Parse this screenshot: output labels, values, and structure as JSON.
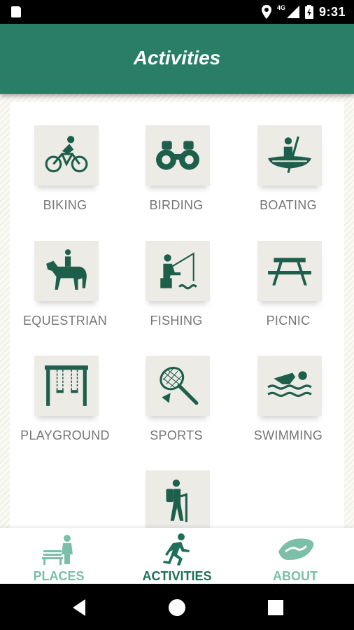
{
  "status_bar": {
    "time": "9:31",
    "network": "4G"
  },
  "app_bar": {
    "title": "Activities"
  },
  "activities": [
    {
      "label": "BIKING",
      "icon": "biking-icon"
    },
    {
      "label": "BIRDING",
      "icon": "binoculars-icon"
    },
    {
      "label": "BOATING",
      "icon": "canoe-icon"
    },
    {
      "label": "EQUESTRIAN",
      "icon": "horse-rider-icon"
    },
    {
      "label": "FISHING",
      "icon": "fishing-icon"
    },
    {
      "label": "PICNIC",
      "icon": "picnic-table-icon"
    },
    {
      "label": "PLAYGROUND",
      "icon": "swing-set-icon"
    },
    {
      "label": "SPORTS",
      "icon": "racket-icon"
    },
    {
      "label": "SWIMMING",
      "icon": "swimmer-icon"
    },
    {
      "label": "",
      "icon": "hiker-icon"
    }
  ],
  "bottom_nav": {
    "places": "PLACES",
    "activities": "ACTIVITIES",
    "about": "ABOUT",
    "active": "activities"
  },
  "colors": {
    "primary": "#2a7e68",
    "icon": "#1e5f4c",
    "tile_bg": "#ecebe6",
    "label_gray": "#757575",
    "nav_inactive": "#7bbfa9",
    "nav_active": "#1e6e58"
  }
}
